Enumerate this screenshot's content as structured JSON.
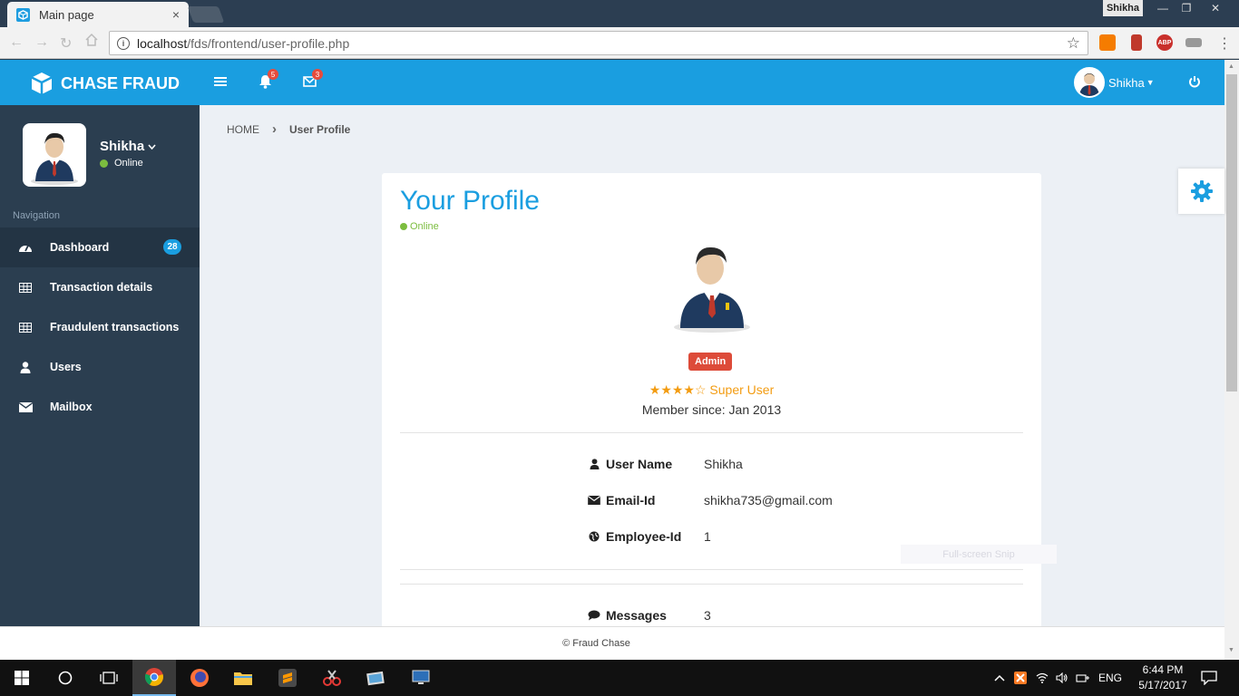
{
  "browser": {
    "tab_title": "Main page",
    "tab_close": "×",
    "profile_chip": "Shikha",
    "url_host": "localhost",
    "url_path": "/fds/frontend/user-profile.php",
    "window_buttons": [
      "—",
      "❐",
      "✕"
    ]
  },
  "header": {
    "brand": "CHASE FRAUD",
    "notifications_count": "5",
    "messages_count": "3",
    "user_name": "Shikha"
  },
  "sidebar": {
    "user_name": "Shikha",
    "status": "Online",
    "nav_heading": "Navigation",
    "items": [
      {
        "label": "Dashboard",
        "icon": "dashboard-icon",
        "badge": "28"
      },
      {
        "label": "Transaction details",
        "icon": "table-icon"
      },
      {
        "label": "Fraudulent transactions",
        "icon": "table-icon"
      },
      {
        "label": "Users",
        "icon": "user-icon"
      },
      {
        "label": "Mailbox",
        "icon": "envelope-icon"
      }
    ]
  },
  "breadcrumb": {
    "home": "HOME",
    "separator": "›",
    "current": "User Profile"
  },
  "profile": {
    "title": "Your Profile",
    "status": "Online",
    "role": "Admin",
    "stars": "★★★★☆",
    "rank": "Super User",
    "member_since": "Member since: Jan 2013",
    "fields": [
      {
        "label": "User Name",
        "value": "Shikha",
        "icon": "user-icon"
      },
      {
        "label": "Email-Id",
        "value": "shikha735@gmail.com",
        "icon": "envelope-icon"
      },
      {
        "label": "Employee-Id",
        "value": "1",
        "icon": "globe-icon"
      }
    ],
    "messages": {
      "label": "Messages",
      "value": "3",
      "icon": "comment-icon"
    }
  },
  "overlay_tip": "Full-screen Snip",
  "footer": "© Fraud Chase",
  "taskbar": {
    "language": "ENG",
    "time": "6:44 PM",
    "date": "5/17/2017"
  },
  "colors": {
    "primary": "#1a9ee0",
    "sidebar": "#2b3e50",
    "danger": "#dd4b39",
    "success": "#7cbd3f",
    "warning": "#f39c12"
  }
}
